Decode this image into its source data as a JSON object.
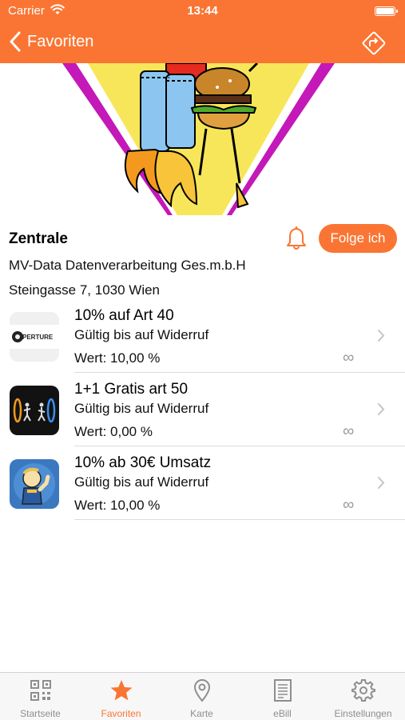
{
  "status_bar": {
    "carrier": "Carrier",
    "time": "13:44"
  },
  "nav": {
    "back_label": "Favoriten"
  },
  "place": {
    "name": "Zentrale",
    "follow_label": "Folge ich",
    "company": "MV-Data Datenverarbeitung Ges.m.b.H",
    "address": "Steingasse 7, 1030 Wien"
  },
  "offers": [
    {
      "title": "10% auf Art 40",
      "validity": "Gültig bis auf Widerruf",
      "value": "Wert: 10,00 %",
      "quantity": "∞",
      "thumb_text": "PERTURE"
    },
    {
      "title": "1+1 Gratis art 50",
      "validity": "Gültig bis auf Widerruf",
      "value": "Wert: 0,00 %",
      "quantity": "∞"
    },
    {
      "title": "10% ab 30€ Umsatz",
      "validity": "Gültig bis auf Widerruf",
      "value": "Wert: 10,00 %",
      "quantity": "∞"
    }
  ],
  "tabs": [
    {
      "label": "Startseite",
      "icon": "qr-code-icon"
    },
    {
      "label": "Favoriten",
      "icon": "star-icon",
      "active": true
    },
    {
      "label": "Karte",
      "icon": "map-pin-icon"
    },
    {
      "label": "eBill",
      "icon": "receipt-icon"
    },
    {
      "label": "Einstellungen",
      "icon": "gear-icon"
    }
  ],
  "colors": {
    "accent": "#fa7533",
    "tab_inactive": "#8e8e8e",
    "separator": "#dcdcdc"
  }
}
